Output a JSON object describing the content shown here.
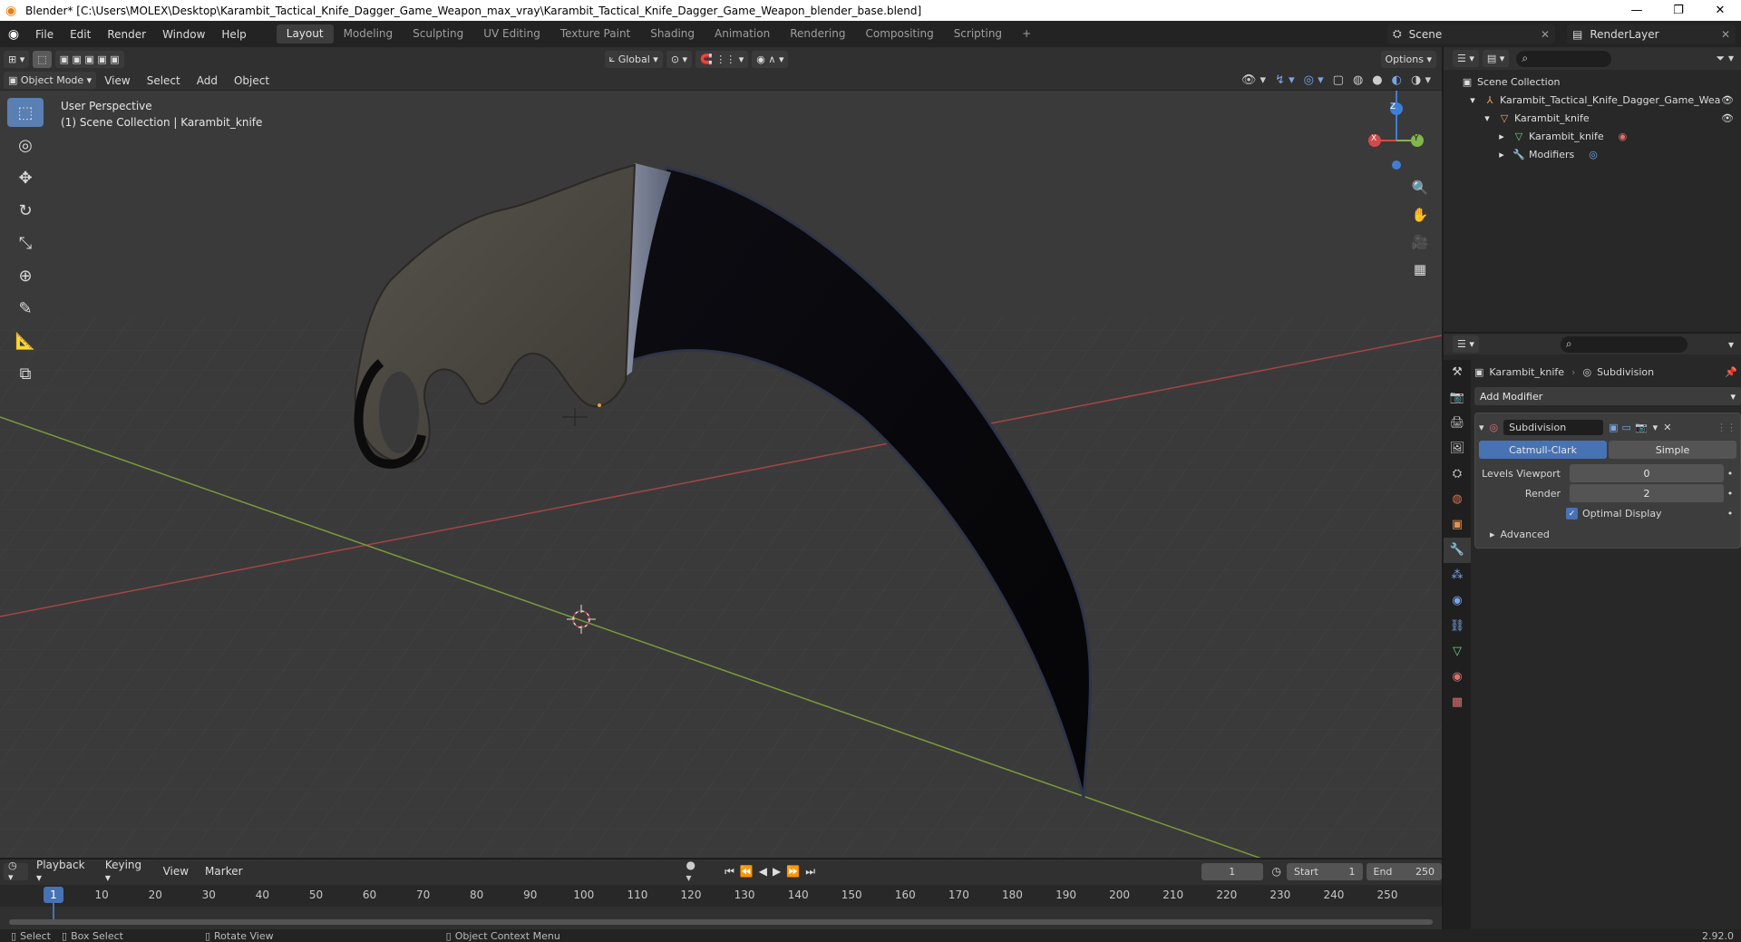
{
  "window": {
    "title": "Blender* [C:\\Users\\MOLEX\\Desktop\\Karambit_Tactical_Knife_Dagger_Game_Weapon_max_vray\\Karambit_Tactical_Knife_Dagger_Game_Weapon_blender_base.blend]",
    "minimize": "—",
    "restore": "❐",
    "close": "✕"
  },
  "menu": [
    "File",
    "Edit",
    "Render",
    "Window",
    "Help"
  ],
  "workspaces": [
    "Layout",
    "Modeling",
    "Sculpting",
    "UV Editing",
    "Texture Paint",
    "Shading",
    "Animation",
    "Rendering",
    "Compositing",
    "Scripting"
  ],
  "active_workspace": "Layout",
  "scene": "Scene",
  "render_layer": "RenderLayer",
  "viewport": {
    "orientation": "Global",
    "options": "Options",
    "mode": "Object Mode",
    "menus": [
      "View",
      "Select",
      "Add",
      "Object"
    ],
    "perspective": "User Perspective",
    "collection_info": "(1) Scene Collection | Karambit_knife",
    "gizmo": {
      "x": "X",
      "y": "Y",
      "z": "Z"
    }
  },
  "outliner": {
    "root": "Scene Collection",
    "items": [
      {
        "label": "Karambit_Tactical_Knife_Dagger_Game_Wea",
        "icon": "empty-icon"
      },
      {
        "label": "Karambit_knife",
        "icon": "object-icon"
      },
      {
        "label": "Karambit_knife",
        "icon": "mesh-icon"
      },
      {
        "label": "Modifiers",
        "icon": "wrench-icon"
      }
    ]
  },
  "properties": {
    "object_name": "Karambit_knife",
    "modifier_context": "Subdivision",
    "add_modifier": "Add Modifier",
    "modifier": {
      "name": "Subdivision",
      "type_a": "Catmull-Clark",
      "type_b": "Simple",
      "levels_label": "Levels Viewport",
      "levels_value": "0",
      "render_label": "Render",
      "render_value": "2",
      "optimal_display": "Optimal Display",
      "advanced": "Advanced"
    }
  },
  "timeline": {
    "menus": [
      "Playback",
      "Keying",
      "View",
      "Marker"
    ],
    "current_frame": "1",
    "start_label": "Start",
    "start": "1",
    "end_label": "End",
    "end": "250",
    "ticks": [
      "1",
      "10",
      "20",
      "30",
      "40",
      "50",
      "60",
      "70",
      "80",
      "90",
      "100",
      "110",
      "120",
      "130",
      "140",
      "150",
      "160",
      "170",
      "180",
      "190",
      "200",
      "210",
      "220",
      "230",
      "240",
      "250"
    ]
  },
  "status": {
    "select": "Select",
    "box_select": "Box Select",
    "rotate_view": "Rotate View",
    "context_menu": "Object Context Menu",
    "version": "2.92.0"
  },
  "colors": {
    "accent": "#5a7fb3",
    "x_axis": "#d24a4a",
    "y_axis": "#82b64c",
    "z_axis": "#3d7fd6"
  }
}
